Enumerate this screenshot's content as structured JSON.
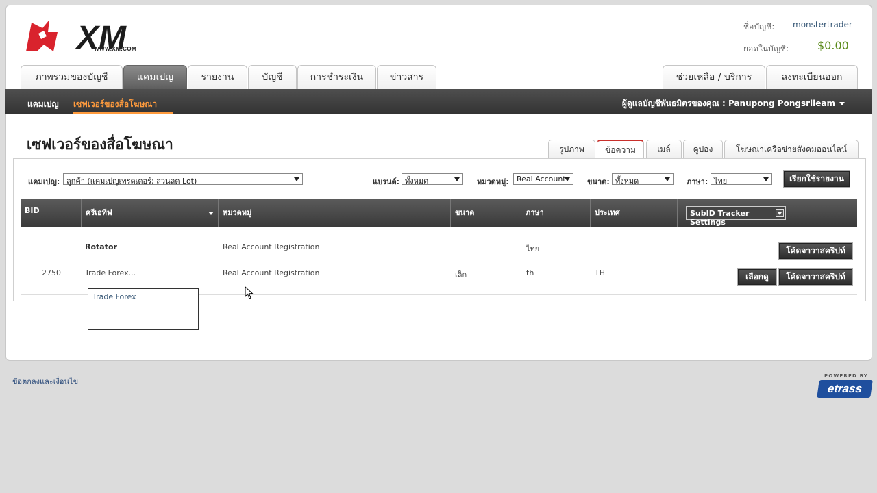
{
  "logo": {
    "url_text": "WWW.XM.COM",
    "brand_color": "#d9232d"
  },
  "account": {
    "name_label": "ชื่อบัญชี:",
    "name_value": "monstertrader",
    "balance_label": "ยอดในบัญชี:",
    "balance_value": "$0.00"
  },
  "main_tabs": [
    "ภาพรวมของบัญชี",
    "แคมเปญ",
    "รายงาน",
    "บัญชี",
    "การชำระเงิน",
    "ข่าวสาร"
  ],
  "right_tabs": [
    "ช่วยเหลือ / บริการ",
    "ลงทะเบียนออก"
  ],
  "subnav": {
    "items": [
      "แคมเปญ",
      "เซฟเวอร์ของสื่อโฆษณา"
    ],
    "manager": "ผู้ดูแลบัญชีพันธมิตรของคุณ : Panupong Pongsriieam"
  },
  "page_title": "เซฟเวอร์ของสื่อโฆษณา",
  "sub_tabs": [
    "รูปภาพ",
    "ข้อความ",
    "เมล์",
    "คูปอง",
    "โฆษณาเครือข่ายสังคมออนไลน์"
  ],
  "filters": {
    "campaign_label": "แคมเปญ:",
    "campaign_value": "ลูกค้า (แคมเปญเทรดเดอร์; ส่วนลด Lot)",
    "brand_label": "แบรนด์:",
    "brand_value": "ทั้งหมด",
    "category_label": "หมวดหมู่:",
    "category_value": "Real Account",
    "size_label": "ขนาด:",
    "size_value": "ทั้งหมด",
    "language_label": "ภาษา:",
    "language_value": "ไทย",
    "run_button": "เรียกใช้รายงาน"
  },
  "table": {
    "columns": [
      "BID",
      "ครีเอทีฟ",
      "หมวดหมู่",
      "ขนาด",
      "ภาษา",
      "ประเทศ"
    ],
    "settings_button": "SubID Tracker Settings",
    "rows": [
      {
        "bid": "",
        "creative": "Rotator",
        "category": "Real Account Registration",
        "size": "",
        "language": "ไทย",
        "country": "",
        "buttons": [
          "โค้ดจาวาสคริปท์"
        ]
      },
      {
        "bid": "2750",
        "creative": "Trade Forex...",
        "category": "Real Account Registration",
        "size": "เล็ก",
        "language": "th",
        "country": "TH",
        "buttons": [
          "เลือกดู",
          "โค้ดจาวาสคริปท์"
        ]
      }
    ]
  },
  "tooltip": "Trade Forex",
  "footer": {
    "terms_link": "ข้อตกลงและเงื่อนไข",
    "powered_by": "POWERED BY",
    "provider": "etrass"
  }
}
